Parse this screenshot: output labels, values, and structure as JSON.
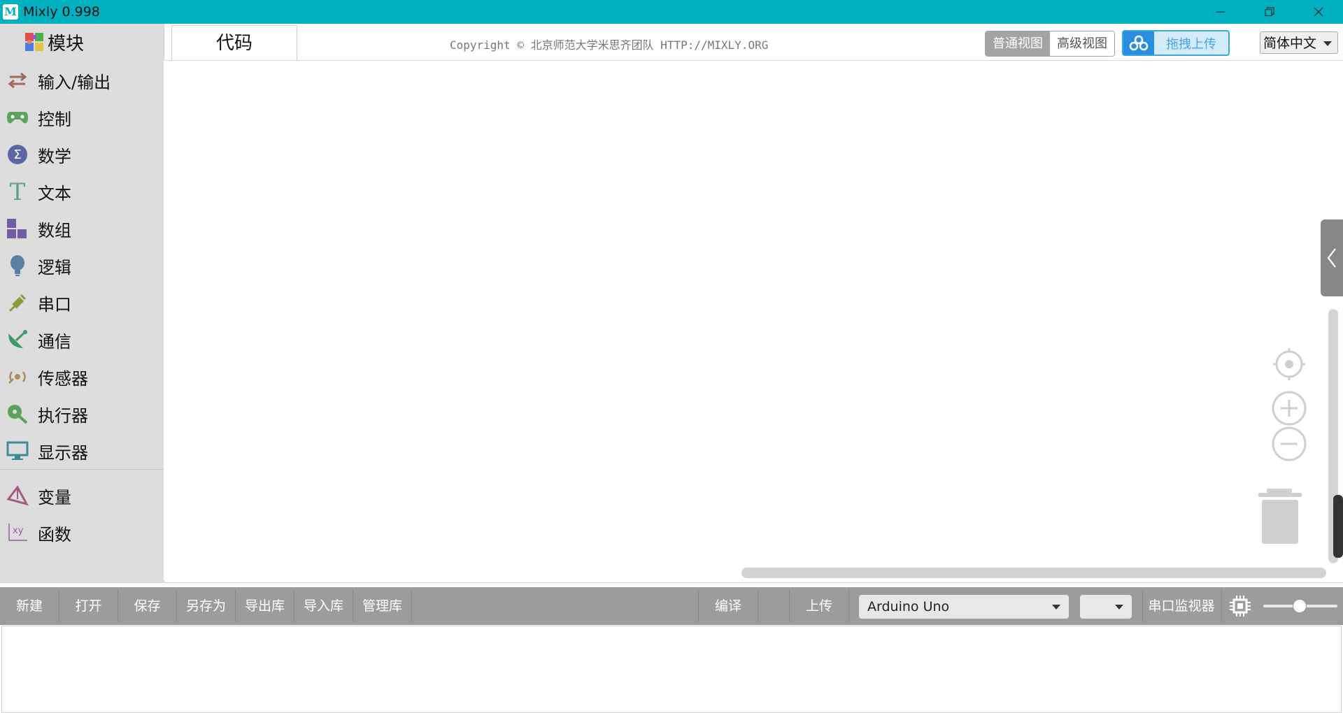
{
  "window": {
    "title": "Mixly 0.998"
  },
  "sidebar": {
    "header": "模块",
    "items": [
      {
        "label": "输入/输出",
        "icon": "arrows-icon",
        "color": "#a0695a"
      },
      {
        "label": "控制",
        "icon": "gamepad-icon",
        "color": "#5ba35b"
      },
      {
        "label": "数学",
        "icon": "sigma-icon",
        "color": "#5b67a5"
      },
      {
        "label": "文本",
        "icon": "text-t-icon",
        "color": "#5ba58c"
      },
      {
        "label": "数组",
        "icon": "blocks-icon",
        "color": "#745ba5"
      },
      {
        "label": "逻辑",
        "icon": "bulb-icon",
        "color": "#5b80a5"
      },
      {
        "label": "串口",
        "icon": "usb-plug-icon",
        "color": "#8a9a3c"
      },
      {
        "label": "通信",
        "icon": "satellite-dish-icon",
        "color": "#3c9a6a"
      },
      {
        "label": "传感器",
        "icon": "sensor-icon",
        "color": "#b08a5a"
      },
      {
        "label": "执行器",
        "icon": "actuator-icon",
        "color": "#5ba35b"
      },
      {
        "label": "显示器",
        "icon": "monitor-icon",
        "color": "#3c8a9a"
      },
      {
        "label": "变量",
        "icon": "variable-icon",
        "color": "#a55b80"
      },
      {
        "label": "函数",
        "icon": "function-xy-icon",
        "color": "#995ba5"
      }
    ]
  },
  "header": {
    "tab_code": "代码",
    "copyright": "Copyright © 北京师范大学米思齐团队 HTTP://MIXLY.ORG",
    "view_normal": "普通视图",
    "view_advanced": "高级视图",
    "drag_upload": "拖拽上传",
    "language": "简体中文"
  },
  "toolbar": {
    "new": "新建",
    "open": "打开",
    "save": "保存",
    "save_as": "另存为",
    "export_lib": "导出库",
    "import_lib": "导入库",
    "manage_lib": "管理库",
    "compile": "编译",
    "upload": "上传",
    "board": "Arduino Uno",
    "port": "",
    "serial_monitor": "串口监视器"
  },
  "colors": {
    "titlebar": "#01b1c1",
    "sidebar_bg": "#dddddd",
    "toolbar_bg": "#9c9c9c",
    "accent_blue": "#3aa7e2"
  }
}
